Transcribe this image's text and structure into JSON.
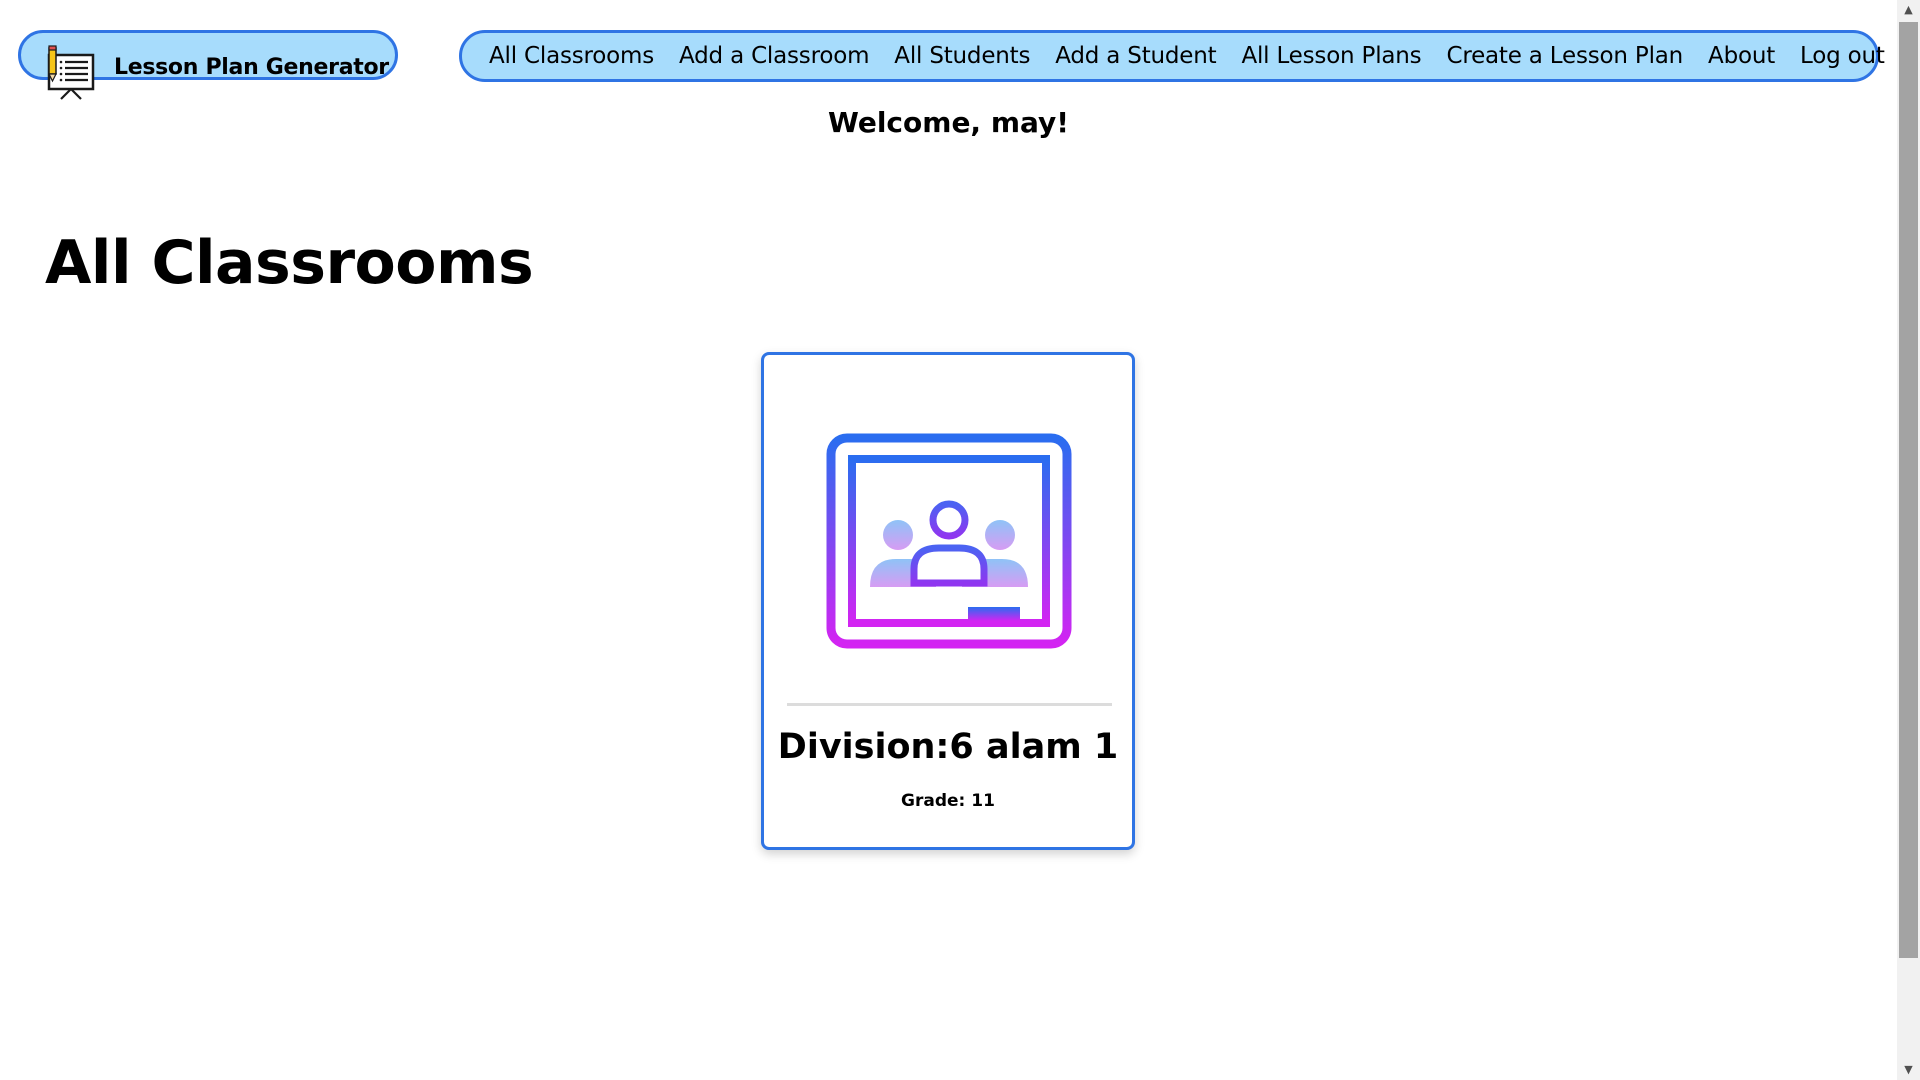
{
  "brand": {
    "title": "Lesson Plan Generator",
    "icon": "lesson-plan-board-icon"
  },
  "nav": {
    "items": [
      {
        "label": "All Classrooms"
      },
      {
        "label": "Add a Classroom"
      },
      {
        "label": "All Students"
      },
      {
        "label": "Add a Student"
      },
      {
        "label": "All Lesson Plans"
      },
      {
        "label": "Create a Lesson Plan"
      },
      {
        "label": "About"
      },
      {
        "label": "Log out"
      }
    ]
  },
  "welcome": "Welcome, may!",
  "page_title": "All Classrooms",
  "classrooms": [
    {
      "icon": "google-classroom-icon",
      "title": "Division:6 alam 1",
      "subtitle": "Grade: 11"
    }
  ],
  "colors": {
    "nav_background": "#a7dcfc",
    "nav_border": "#2f74e4",
    "card_border": "#2f74e4",
    "icon_gradient_top": "#2a6df0",
    "icon_gradient_bottom": "#d324f2"
  },
  "scrollbar": {
    "up_icon": "scroll-up-arrow-icon",
    "down_icon": "scroll-down-arrow-icon"
  }
}
